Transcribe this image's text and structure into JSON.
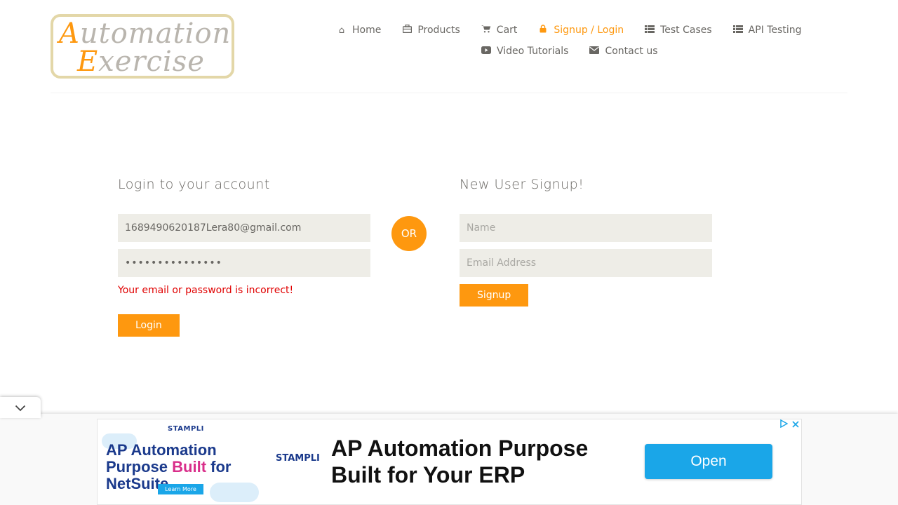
{
  "logo": {
    "line1_cap": "A",
    "line1_rest": "utomation",
    "line2_cap": "E",
    "line2_rest": "xercise"
  },
  "nav": {
    "items": [
      {
        "label": "Home",
        "icon": "home-icon"
      },
      {
        "label": "Products",
        "icon": "briefcase-icon"
      },
      {
        "label": "Cart",
        "icon": "cart-icon"
      },
      {
        "label": "Signup / Login",
        "icon": "lock-icon",
        "active": true
      },
      {
        "label": "Test Cases",
        "icon": "list-icon"
      },
      {
        "label": "API Testing",
        "icon": "list-icon"
      },
      {
        "label": "Video Tutorials",
        "icon": "youtube-play-icon"
      },
      {
        "label": "Contact us",
        "icon": "envelope-icon"
      }
    ]
  },
  "login": {
    "title": "Login to your account",
    "email_value": "1689490620187Lera80@gmail.com",
    "password_value": "•••••••••••••••",
    "error": "Your email or password is incorrect!",
    "button": "Login"
  },
  "or_label": "OR",
  "signup": {
    "title": "New User Signup!",
    "name_placeholder": "Name",
    "email_placeholder": "Email Address",
    "button": "Signup"
  },
  "ad": {
    "brand": "STAMPLI",
    "left_title_1": "AP Automation",
    "left_title_2a": "Purpose ",
    "left_title_2b": "Built",
    "left_title_2c": " for NetSuite",
    "learn_more": "Learn More",
    "headline": "AP Automation Purpose Built for Your ERP",
    "cta": "Open"
  },
  "colors": {
    "accent": "#fe980f",
    "error": "#e00000",
    "input_bg": "#eeede7",
    "ad_blue": "#1aa6e8"
  }
}
